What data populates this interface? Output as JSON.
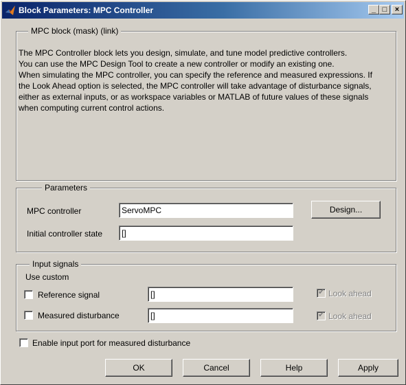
{
  "window": {
    "title": "Block Parameters: MPC Controller"
  },
  "titlebar_buttons": {
    "minimize": "_",
    "maximize": "□",
    "close": "×"
  },
  "mask_group": {
    "legend": "MPC block (mask) (link)",
    "description": [
      "The MPC Controller block lets you design, simulate, and tune model predictive controllers.",
      "You can use the MPC Design Tool to create a new controller or modify an existing one.",
      "When simulating the MPC controller, you can specify the reference and measured expressions. If the Look Ahead option is selected, the MPC controller will take advantage of disturbance signals, either as external inputs, or as workspace variables or MATLAB of future values of these signals when computing current control actions."
    ]
  },
  "parameters_group": {
    "legend": "Parameters",
    "mpc_controller_label": "MPC controller",
    "mpc_controller_value": "ServoMPC",
    "design_button": "Design...",
    "initial_state_label": "Initial controller state",
    "initial_state_value": "[]"
  },
  "input_signals_group": {
    "legend": "Input signals",
    "use_custom_label": "Use custom",
    "reference_label": "Reference signal",
    "reference_value": "[]",
    "reference_checked": false,
    "measured_label": "Measured disturbance",
    "measured_value": "[]",
    "measured_checked": false,
    "look_ahead_label_1": "Look ahead",
    "look_ahead_label_2": "Look ahead",
    "look_ahead_checked": true
  },
  "enable_port": {
    "label": "Enable input port for measured disturbance",
    "checked": false
  },
  "buttons": {
    "ok": "OK",
    "cancel": "Cancel",
    "help": "Help",
    "apply": "Apply"
  },
  "colors": {
    "face": "#d4d0c8",
    "title_start": "#0a246a",
    "title_end": "#a6caf0",
    "disabled_text": "#808080"
  }
}
